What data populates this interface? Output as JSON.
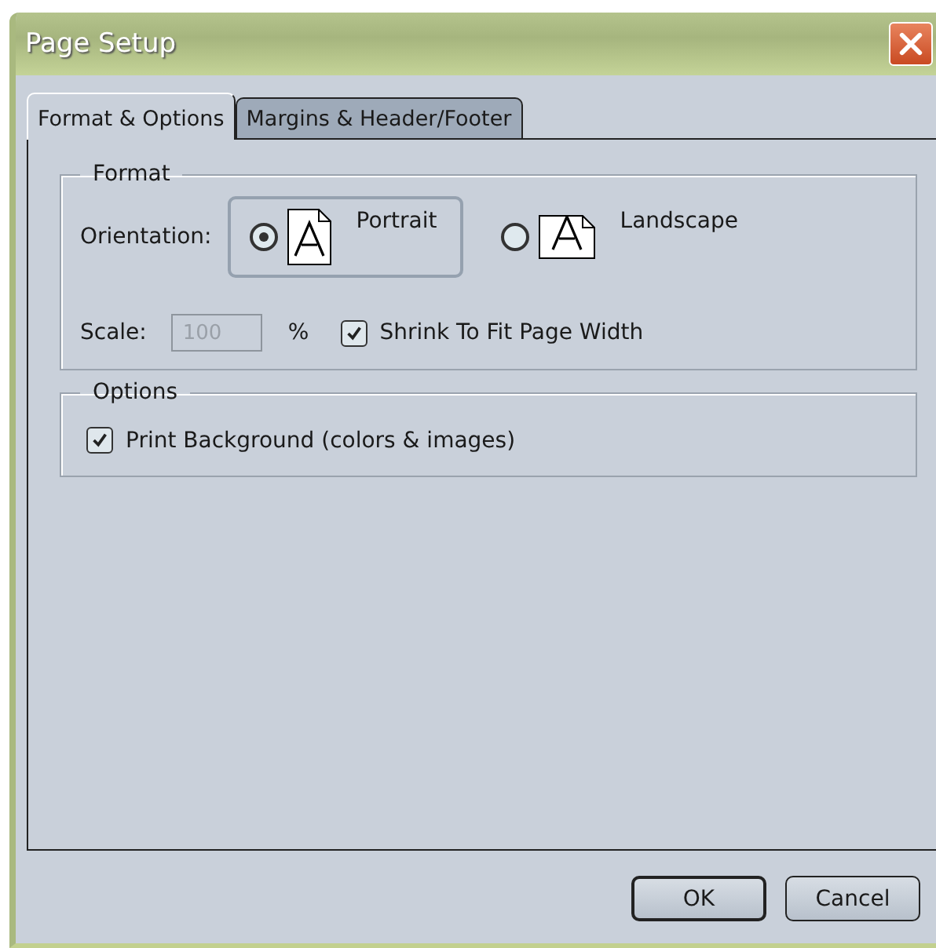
{
  "window": {
    "title": "Page Setup"
  },
  "tabs": [
    {
      "label": "Format & Options",
      "selected": true
    },
    {
      "label": "Margins & Header/Footer",
      "selected": false
    }
  ],
  "format": {
    "title": "Format",
    "orientation_label": "Orientation:",
    "orientations": [
      {
        "label": "Portrait",
        "kind": "portrait",
        "selected": true
      },
      {
        "label": "Landscape",
        "kind": "landscape",
        "selected": false
      }
    ],
    "scale_label": "Scale:",
    "scale_value": "100",
    "scale_disabled": true,
    "scale_unit": "%",
    "shrink": {
      "label": "Shrink To Fit Page Width",
      "checked": true
    }
  },
  "options": {
    "title": "Options",
    "items": [
      {
        "label": "Print Background (colors & images)",
        "checked": true
      }
    ]
  },
  "buttons": [
    {
      "label": "OK",
      "default": true
    },
    {
      "label": "Cancel",
      "default": false
    }
  ]
}
